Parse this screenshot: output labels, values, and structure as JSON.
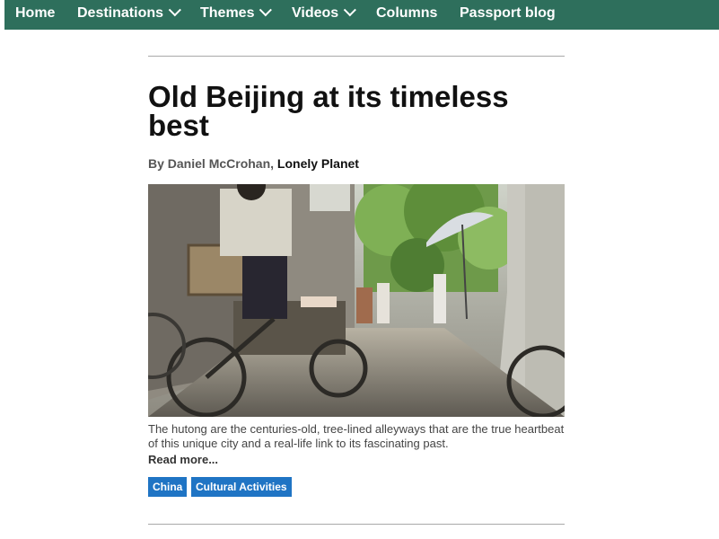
{
  "nav": {
    "items": [
      {
        "label": "Home",
        "has_dropdown": false
      },
      {
        "label": "Destinations",
        "has_dropdown": true
      },
      {
        "label": "Themes",
        "has_dropdown": true
      },
      {
        "label": "Videos",
        "has_dropdown": true
      },
      {
        "label": "Columns",
        "has_dropdown": false
      },
      {
        "label": "Passport blog",
        "has_dropdown": false
      }
    ]
  },
  "article": {
    "title": "Old Beijing at its timeless best",
    "byline_prefix": "By Daniel McCrohan, ",
    "publisher": "Lonely Planet",
    "caption": "The hutong are the centuries-old, tree-lined alleyways that are the true heartbeat of this unique city and a real-life link to its fascinating past.",
    "read_more": "Read more...",
    "tags": [
      "China",
      "Cultural Activities"
    ]
  },
  "colors": {
    "nav_bg": "#2e6f5c",
    "tag_bg": "#1f74c4"
  }
}
